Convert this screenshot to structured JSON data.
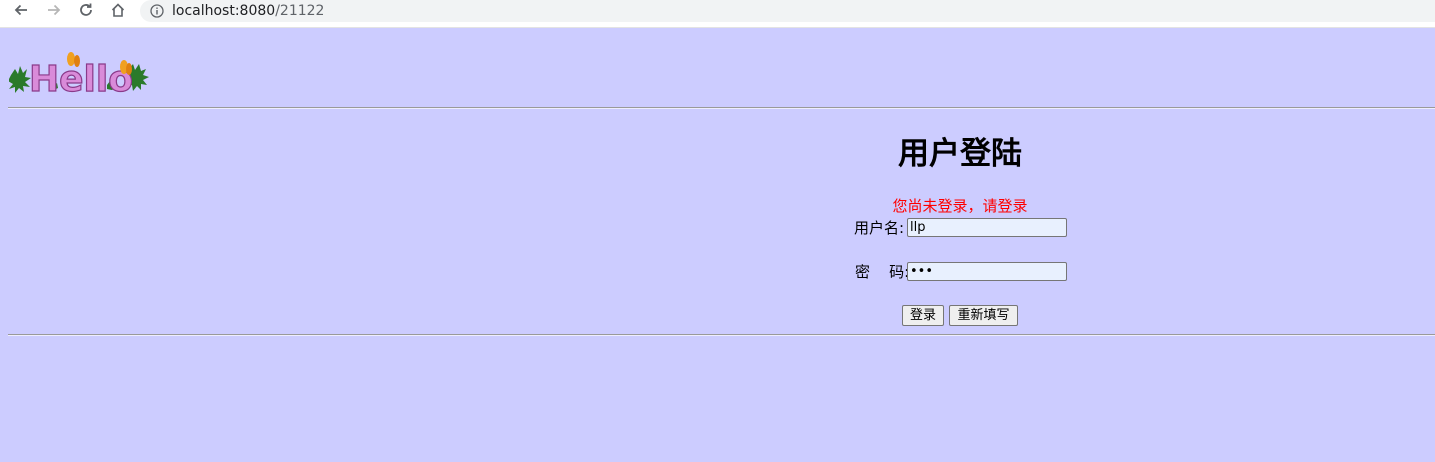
{
  "browser": {
    "url_host": "localhost:8080",
    "url_path": "/21122",
    "icons": [
      "back-arrow-icon",
      "forward-arrow-icon",
      "reload-icon",
      "home-icon",
      "info-icon"
    ]
  },
  "header": {
    "logo_text": "Hello"
  },
  "login": {
    "title": "用户登陆",
    "message": "您尚未登录，请登录",
    "message_color": "#ff0000",
    "username_label": "用户名:",
    "username_value": "llp",
    "password_label": "密    码:",
    "password_value": "•••",
    "login_button": "登录",
    "reset_button": "重新填写"
  },
  "colors": {
    "page_background": "#ccccff",
    "input_background": "#e8f0fe"
  }
}
